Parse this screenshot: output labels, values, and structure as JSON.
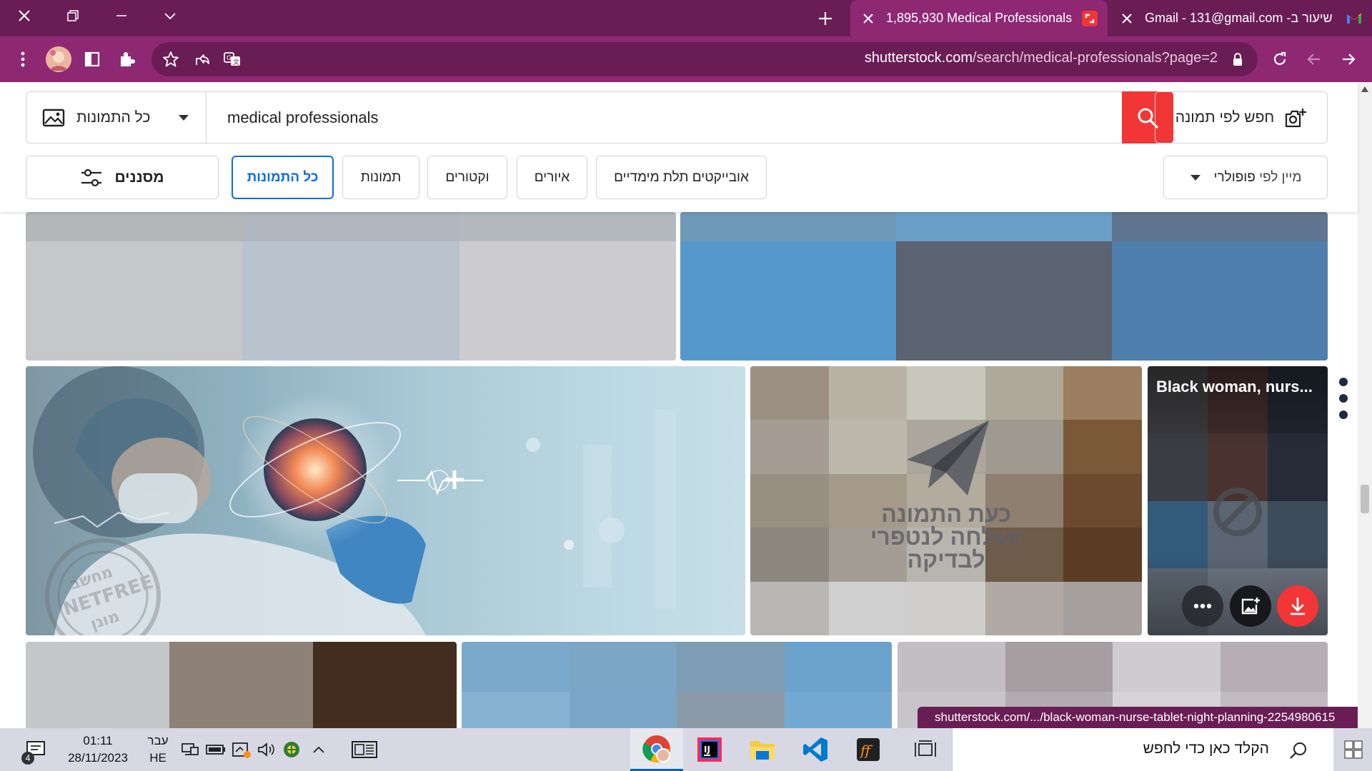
{
  "browser": {
    "tabs": [
      {
        "title": "1,895,930 Medical Professionals",
        "favicon": "shutterstock-icon",
        "active": true
      },
      {
        "title": "שיעור ב- Gmail - 131@gmail.com",
        "favicon": "gmail-icon",
        "active": false
      }
    ],
    "url_host": "shutterstock.com",
    "url_path": "/search/medical-professionals?page=2"
  },
  "search": {
    "type_label": "כל התמונות",
    "query": "medical professionals",
    "image_search_label": "חפש לפי תמונה"
  },
  "filters": {
    "label": "מסננים",
    "pills": [
      "כל התמונות",
      "תמונות",
      "וקטורים",
      "איורים",
      "אובייקטים תלת מימדיים"
    ],
    "selected": "כל התמונות",
    "sort_label": "מיין לפי",
    "sort_value": "פופולרי"
  },
  "results": {
    "blocked_notice_line1": "כעת התמונה",
    "blocked_notice_line2": "נשלחה לנטפרי",
    "blocked_notice_line3": "לבדיקה",
    "hover_title": "Black woman, nurs...",
    "watermark_top": "מחשב",
    "watermark_mid": "NETFREE",
    "watermark_bottom": "מוגן"
  },
  "status_link": "shutterstock.com/.../black-woman-nurse-tablet-night-planning-2254980615",
  "taskbar": {
    "search_placeholder": "הקלד כאן כדי לחפש",
    "time": "01:11",
    "date": "28/11/2023",
    "lang_top": "עבר",
    "lang_bottom": "HE",
    "notification_count": "4"
  },
  "colors": {
    "chrome_dark": "#6a1d55",
    "chrome_light": "#8e2873",
    "accent_red": "#f23535",
    "selected_blue": "#0b6ee0"
  }
}
